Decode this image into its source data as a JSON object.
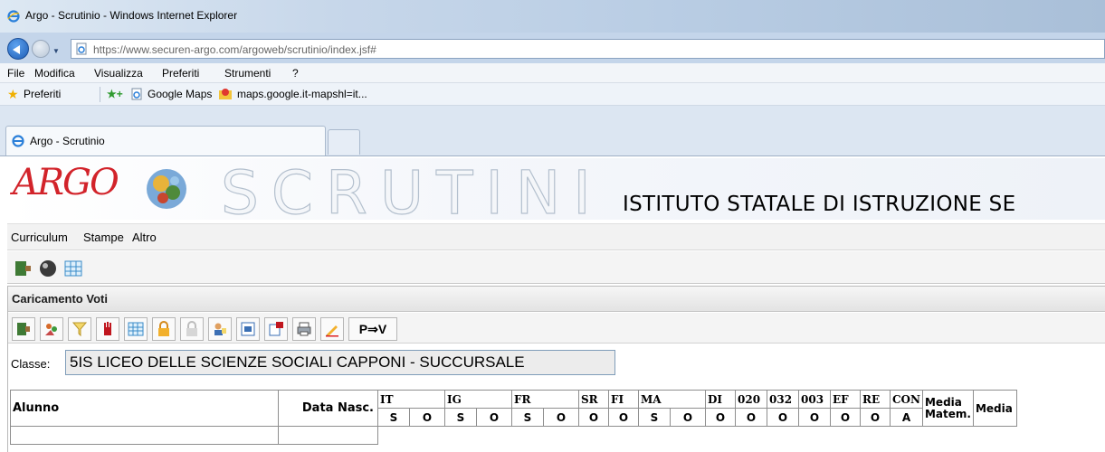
{
  "browser": {
    "window_title": "Argo - Scrutinio - Windows Internet Explorer",
    "url_host": "https://www.securen-argo.com",
    "url_path": "/argoweb/scrutinio/index.jsf#",
    "menu": [
      "File",
      "Modifica",
      "Visualizza",
      "Preferiti",
      "Strumenti",
      "?"
    ],
    "favorites": {
      "label": "Preferiti",
      "items": [
        "Google Maps",
        "maps.google.it-mapshl=it..."
      ]
    },
    "tab": {
      "label": "Argo - Scrutinio"
    }
  },
  "app": {
    "logo_text": "ARGO",
    "banner_title": "SCRUTINI",
    "school_name": "ISTITUTO STATALE DI ISTRUZIONE SE",
    "menu": [
      "Curriculum",
      "Stampe",
      "Altro"
    ],
    "panel": {
      "title": "Caricamento Voti",
      "pv_button": "P⇒V",
      "classe_label": "Classe:",
      "classe_value": "5IS LICEO DELLE SCIENZE SOCIALI CAPPONI - SUCCURSALE"
    },
    "grid": {
      "alunno": "Alunno",
      "data_nasc": "Data Nasc.",
      "subjects": [
        {
          "code": "IT",
          "cols": [
            "S",
            "O"
          ]
        },
        {
          "code": "IG",
          "cols": [
            "S",
            "O"
          ]
        },
        {
          "code": "FR",
          "cols": [
            "S",
            "O"
          ]
        },
        {
          "code": "SR",
          "cols": [
            "O"
          ]
        },
        {
          "code": "FI",
          "cols": [
            "O"
          ]
        },
        {
          "code": "MA",
          "cols": [
            "S",
            "O"
          ]
        },
        {
          "code": "DI",
          "cols": [
            "O"
          ]
        },
        {
          "code": "020",
          "cols": [
            "O"
          ]
        },
        {
          "code": "032",
          "cols": [
            "O"
          ]
        },
        {
          "code": "003",
          "cols": [
            "O"
          ]
        },
        {
          "code": "EF",
          "cols": [
            "O"
          ]
        },
        {
          "code": "RE",
          "cols": [
            "O"
          ]
        },
        {
          "code": "CON",
          "cols": [
            "A"
          ]
        }
      ],
      "media_matem": "Media Matem.",
      "media": "Media"
    }
  }
}
